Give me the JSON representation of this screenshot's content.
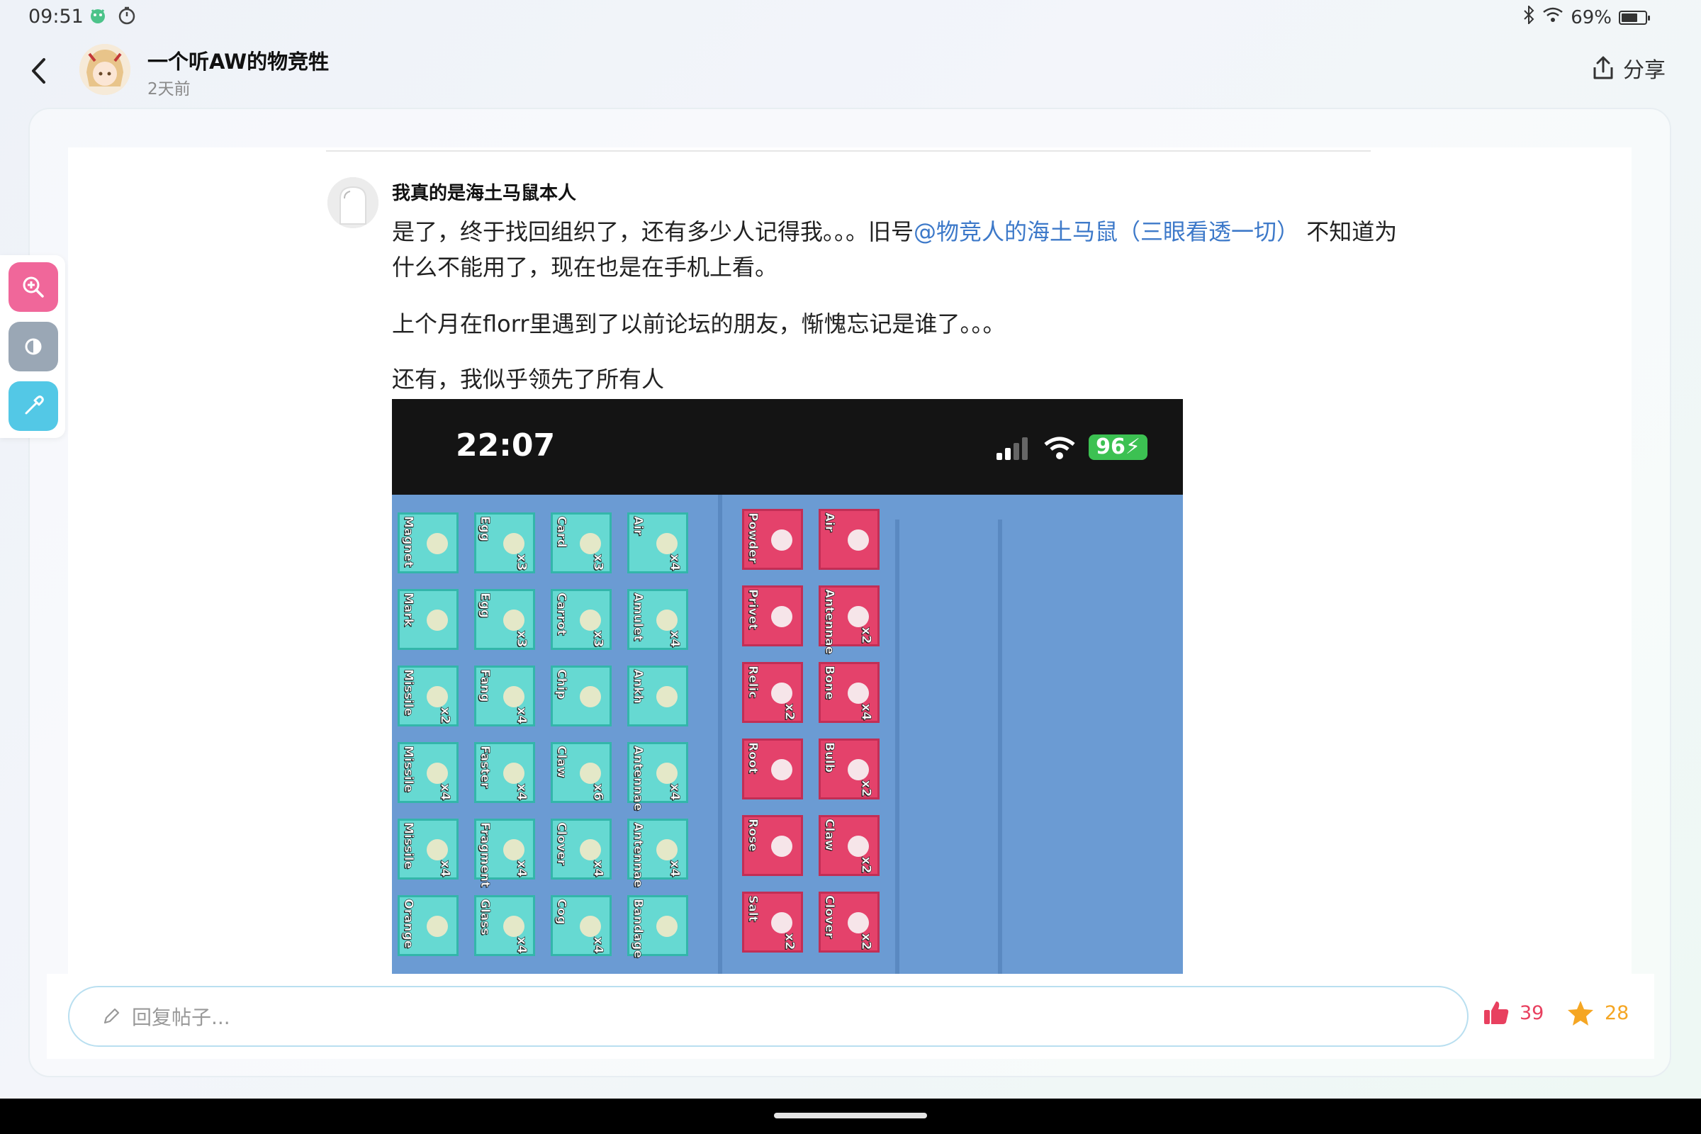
{
  "status_bar": {
    "time": "09:51",
    "battery": "69%",
    "battery_level": 0.69
  },
  "header": {
    "author": "一个听AW的物竞牲",
    "time": "2天前",
    "share_label": "分享"
  },
  "reply": {
    "author": "我真的是海土马鼠本人",
    "p1_before": "是了，终于找回组织了，还有多少人记得我。。。旧号",
    "p1_mention": "@物竞人的海土马鼠（三眼看透一切）",
    "p1_after": " 不知道为什么不能用了，现在也是在手机上看。",
    "p2": "上个月在florr里遇到了以前论坛的朋友，惭愧忘记是谁了。。。",
    "p3": "还有，我似乎领先了所有人"
  },
  "screenshot": {
    "time": "22:07",
    "battery": "96",
    "left_grid": [
      [
        {
          "name": "Magnet",
          "count": ""
        },
        {
          "name": "Egg",
          "count": "x3"
        },
        {
          "name": "Card",
          "count": "x3"
        },
        {
          "name": "Air",
          "count": "x4"
        }
      ],
      [
        {
          "name": "Mark",
          "count": ""
        },
        {
          "name": "Egg",
          "count": "x3"
        },
        {
          "name": "Carrot",
          "count": "x3"
        },
        {
          "name": "Amulet",
          "count": "x4"
        }
      ],
      [
        {
          "name": "Missile",
          "count": "x2"
        },
        {
          "name": "Fang",
          "count": "x4"
        },
        {
          "name": "Chip",
          "count": ""
        },
        {
          "name": "Ankh",
          "count": ""
        }
      ],
      [
        {
          "name": "Missile",
          "count": "x4"
        },
        {
          "name": "Faster",
          "count": "x4"
        },
        {
          "name": "Claw",
          "count": "x6"
        },
        {
          "name": "Antennae",
          "count": "x4"
        }
      ],
      [
        {
          "name": "Missile",
          "count": "x4"
        },
        {
          "name": "Fragment",
          "count": "x4"
        },
        {
          "name": "Clover",
          "count": "x4"
        },
        {
          "name": "Antennae",
          "count": "x4"
        }
      ],
      [
        {
          "name": "Orange",
          "count": ""
        },
        {
          "name": "Glass",
          "count": "x4"
        },
        {
          "name": "Cog",
          "count": "x4"
        },
        {
          "name": "Bandage",
          "count": ""
        }
      ]
    ],
    "right_grid": [
      [
        {
          "name": "Powder",
          "count": ""
        },
        {
          "name": "Air",
          "count": ""
        }
      ],
      [
        {
          "name": "Privet",
          "count": ""
        },
        {
          "name": "Antennae",
          "count": "x2"
        }
      ],
      [
        {
          "name": "Relic",
          "count": "x2"
        },
        {
          "name": "Bone",
          "count": "x4"
        }
      ],
      [
        {
          "name": "Root",
          "count": ""
        },
        {
          "name": "Bulb",
          "count": "x2"
        }
      ],
      [
        {
          "name": "Rose",
          "count": ""
        },
        {
          "name": "Claw",
          "count": "x2"
        }
      ],
      [
        {
          "name": "Salt",
          "count": "x2"
        },
        {
          "name": "Clover",
          "count": "x2"
        }
      ]
    ]
  },
  "reply_bar": {
    "placeholder": "回复帖子...",
    "likes": "39",
    "favorites": "28"
  }
}
